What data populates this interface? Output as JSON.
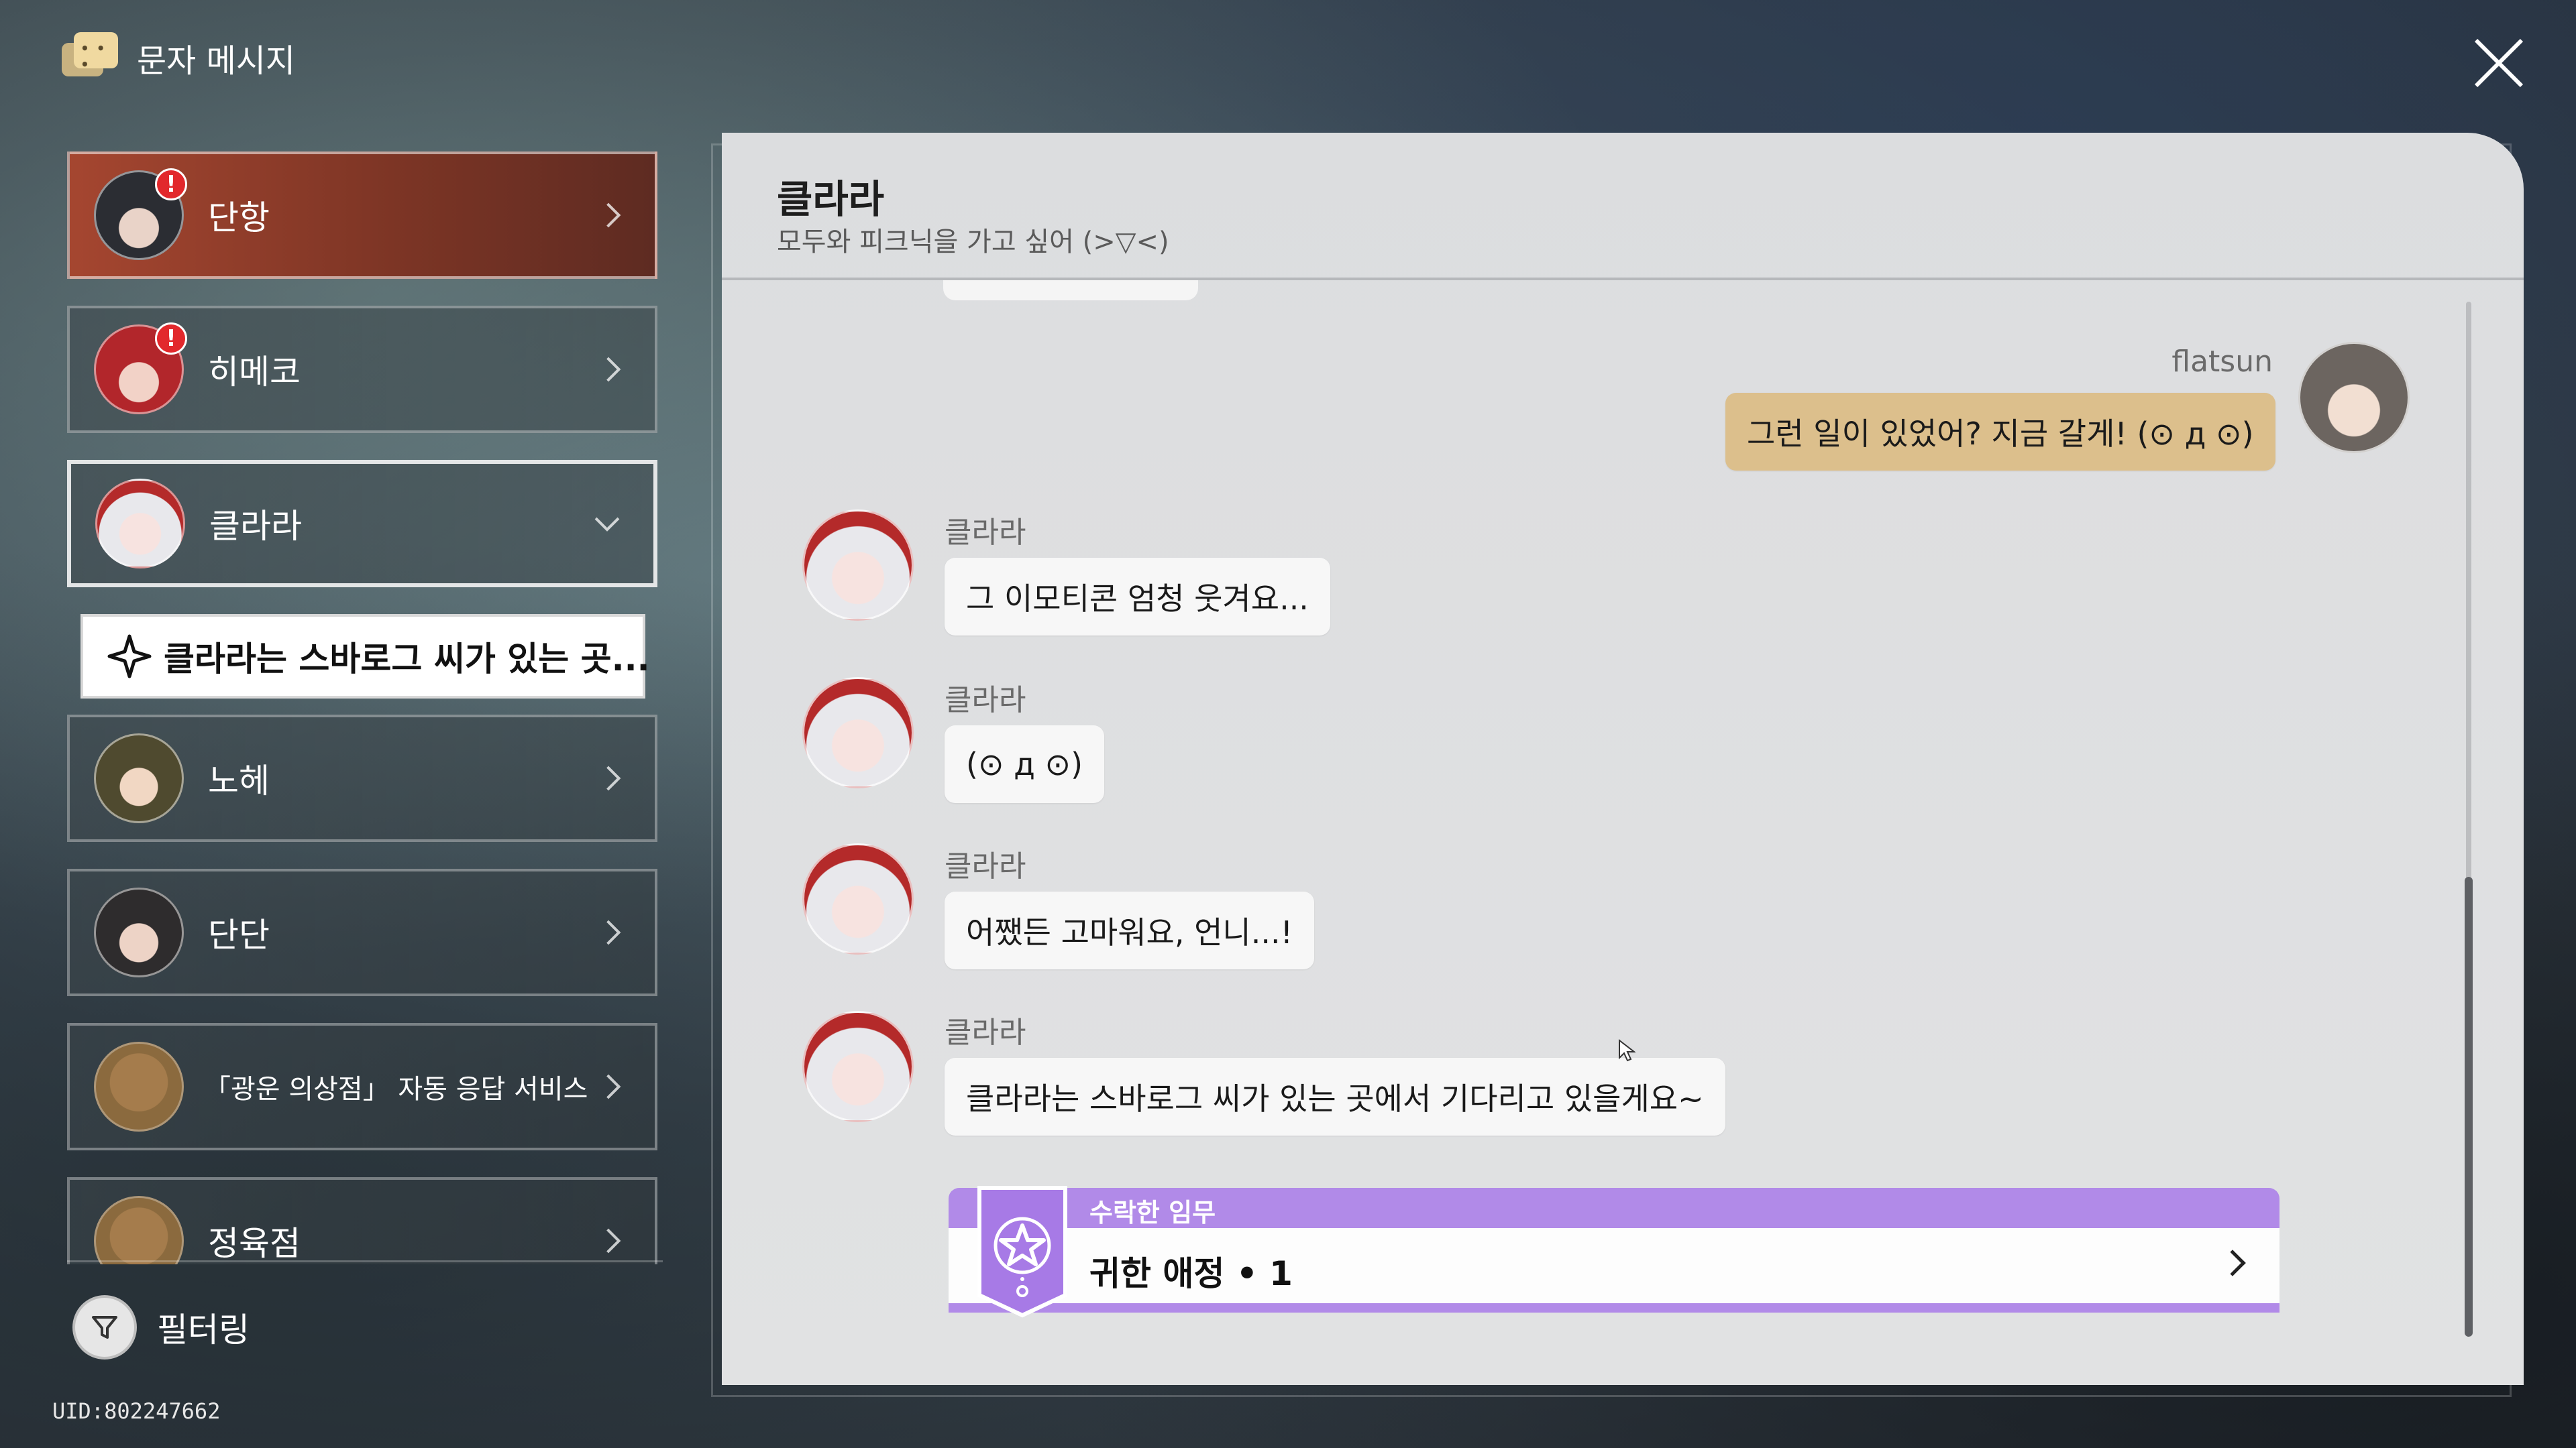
{
  "header": {
    "title": "문자 메시지",
    "icon": "message-bubbles-icon",
    "close_icon": "close-icon"
  },
  "contacts": [
    {
      "name": "단항",
      "badge": "!",
      "state": "unread-highlighted"
    },
    {
      "name": "히메코",
      "badge": "!",
      "state": "unread"
    },
    {
      "name": "클라라",
      "state": "expanded"
    },
    {
      "name": "노헤"
    },
    {
      "name": "단단"
    },
    {
      "name": "「광운 의상점」 자동 응답 서비스"
    },
    {
      "name": "정육점"
    }
  ],
  "expanded_quest": {
    "label": "클라라는 스바로그 씨가 있는 곳...",
    "icon": "four-point-star-icon"
  },
  "filter": {
    "label": "필터링"
  },
  "uid": "UID:802247662",
  "chat": {
    "contact_name": "클라라",
    "contact_status": "모두와 피크닉을 가고 싶어 (>▽<)",
    "messages": [
      {
        "sender": "flatsun",
        "text": "그런 일이 있었어? 지금 갈게! (⊙ д ⊙)",
        "mine": true
      },
      {
        "sender": "클라라",
        "text": "그 이모티콘 엄청 웃겨요...",
        "mine": false
      },
      {
        "sender": "클라라",
        "text": "(⊙ д ⊙)",
        "mine": false
      },
      {
        "sender": "클라라",
        "text": "어쨌든 고마워요, 언니...!",
        "mine": false
      },
      {
        "sender": "클라라",
        "text": "클라라는 스바로그 씨가 있는 곳에서 기다리고 있을게요~",
        "mine": false
      }
    ],
    "mission": {
      "header": "수락한 임무",
      "title": "귀한 애정 • 1",
      "accent": "#b18ae8"
    }
  },
  "colors": {
    "highlight_contact": "#a54630",
    "my_bubble": "#dcbf8c",
    "badge": "#e2282c"
  }
}
